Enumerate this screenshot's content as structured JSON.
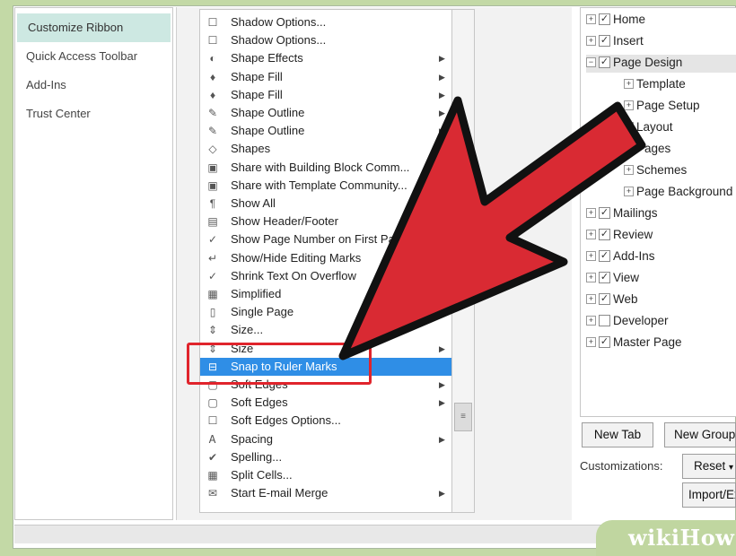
{
  "sidebar": {
    "items": [
      {
        "label": "Customize Ribbon",
        "selected": true
      },
      {
        "label": "Quick Access Toolbar",
        "selected": false
      },
      {
        "label": "Add-Ins",
        "selected": false
      },
      {
        "label": "Trust Center",
        "selected": false
      }
    ]
  },
  "commands": [
    {
      "label": "Shadow Options...",
      "icon": "checkbox-icon",
      "arrow": false
    },
    {
      "label": "Shadow Options...",
      "icon": "checkbox-icon",
      "arrow": false
    },
    {
      "label": "Shape Effects",
      "icon": "shape-effects-icon",
      "arrow": true
    },
    {
      "label": "Shape Fill",
      "icon": "paint-bucket-icon",
      "arrow": true
    },
    {
      "label": "Shape Fill",
      "icon": "paint-bucket-icon",
      "arrow": true
    },
    {
      "label": "Shape Outline",
      "icon": "pen-icon",
      "arrow": true
    },
    {
      "label": "Shape Outline",
      "icon": "pen-icon",
      "arrow": true
    },
    {
      "label": "Shapes",
      "icon": "shapes-icon",
      "arrow": false
    },
    {
      "label": "Share with Building Block Comm...",
      "icon": "share-icon",
      "arrow": false
    },
    {
      "label": "Share with Template Community...",
      "icon": "share-icon",
      "arrow": false
    },
    {
      "label": "Show All",
      "icon": "pilcrow-icon",
      "arrow": false
    },
    {
      "label": "Show Header/Footer",
      "icon": "header-footer-icon",
      "arrow": false
    },
    {
      "label": "Show Page Number on First Pa",
      "icon": "check-icon",
      "arrow": false
    },
    {
      "label": "Show/Hide Editing Marks",
      "icon": "editing-marks-icon",
      "arrow": false
    },
    {
      "label": "Shrink Text On Overflow",
      "icon": "check-icon",
      "arrow": false
    },
    {
      "label": "Simplified",
      "icon": "simplified-icon",
      "arrow": false
    },
    {
      "label": "Single Page",
      "icon": "single-page-icon",
      "arrow": false
    },
    {
      "label": "Size...",
      "icon": "size-icon",
      "arrow": false
    },
    {
      "label": "Size",
      "icon": "size-icon",
      "arrow": true
    },
    {
      "label": "Snap to Ruler Marks",
      "icon": "snap-icon",
      "arrow": false,
      "highlighted": true
    },
    {
      "label": "Soft Edges",
      "icon": "soft-edges-icon",
      "arrow": true
    },
    {
      "label": "Soft Edges",
      "icon": "soft-edges-icon",
      "arrow": true
    },
    {
      "label": "Soft Edges Options...",
      "icon": "checkbox-icon",
      "arrow": false
    },
    {
      "label": "Spacing",
      "icon": "spacing-icon",
      "arrow": true
    },
    {
      "label": "Spelling...",
      "icon": "spelling-icon",
      "arrow": false
    },
    {
      "label": "Split Cells...",
      "icon": "split-cells-icon",
      "arrow": false
    },
    {
      "label": "Start E-mail Merge",
      "icon": "mail-merge-icon",
      "arrow": true
    }
  ],
  "ribbon_tree": [
    {
      "label": "Home",
      "level": 0,
      "expander": "+",
      "checked": true
    },
    {
      "label": "Insert",
      "level": 0,
      "expander": "+",
      "checked": true
    },
    {
      "label": "Page Design",
      "level": 0,
      "expander": "-",
      "checked": true,
      "selected": true
    },
    {
      "label": "Template",
      "level": 1,
      "expander": "+"
    },
    {
      "label": "Page Setup",
      "level": 1,
      "expander": "+"
    },
    {
      "label": "Layout",
      "level": 1,
      "expander": "+"
    },
    {
      "label": "Pages",
      "level": 1,
      "expander": "+"
    },
    {
      "label": "Schemes",
      "level": 1,
      "expander": "+"
    },
    {
      "label": "Page Background",
      "level": 1,
      "expander": "+"
    },
    {
      "label": "Mailings",
      "level": 0,
      "expander": "+",
      "checked": true
    },
    {
      "label": "Review",
      "level": 0,
      "expander": "+",
      "checked": true
    },
    {
      "label": "Add-Ins",
      "level": 0,
      "expander": "+",
      "checked": true
    },
    {
      "label": "View",
      "level": 0,
      "expander": "+",
      "checked": true
    },
    {
      "label": "Web",
      "level": 0,
      "expander": "+",
      "checked": true
    },
    {
      "label": "Developer",
      "level": 0,
      "expander": "+",
      "checked": false
    },
    {
      "label": "Master Page",
      "level": 0,
      "expander": "+",
      "checked": true
    }
  ],
  "buttons": {
    "new_tab": "New Tab",
    "new_group": "New Group",
    "customizations_label": "Customizations:",
    "reset": "Reset",
    "reset_arrow": "▾",
    "import_export": "Import/Export"
  },
  "watermark": "wikiHow",
  "colors": {
    "highlight": "#2f8ee6",
    "annotation_red": "#e0242c",
    "selected_nav": "#cde8e2"
  }
}
